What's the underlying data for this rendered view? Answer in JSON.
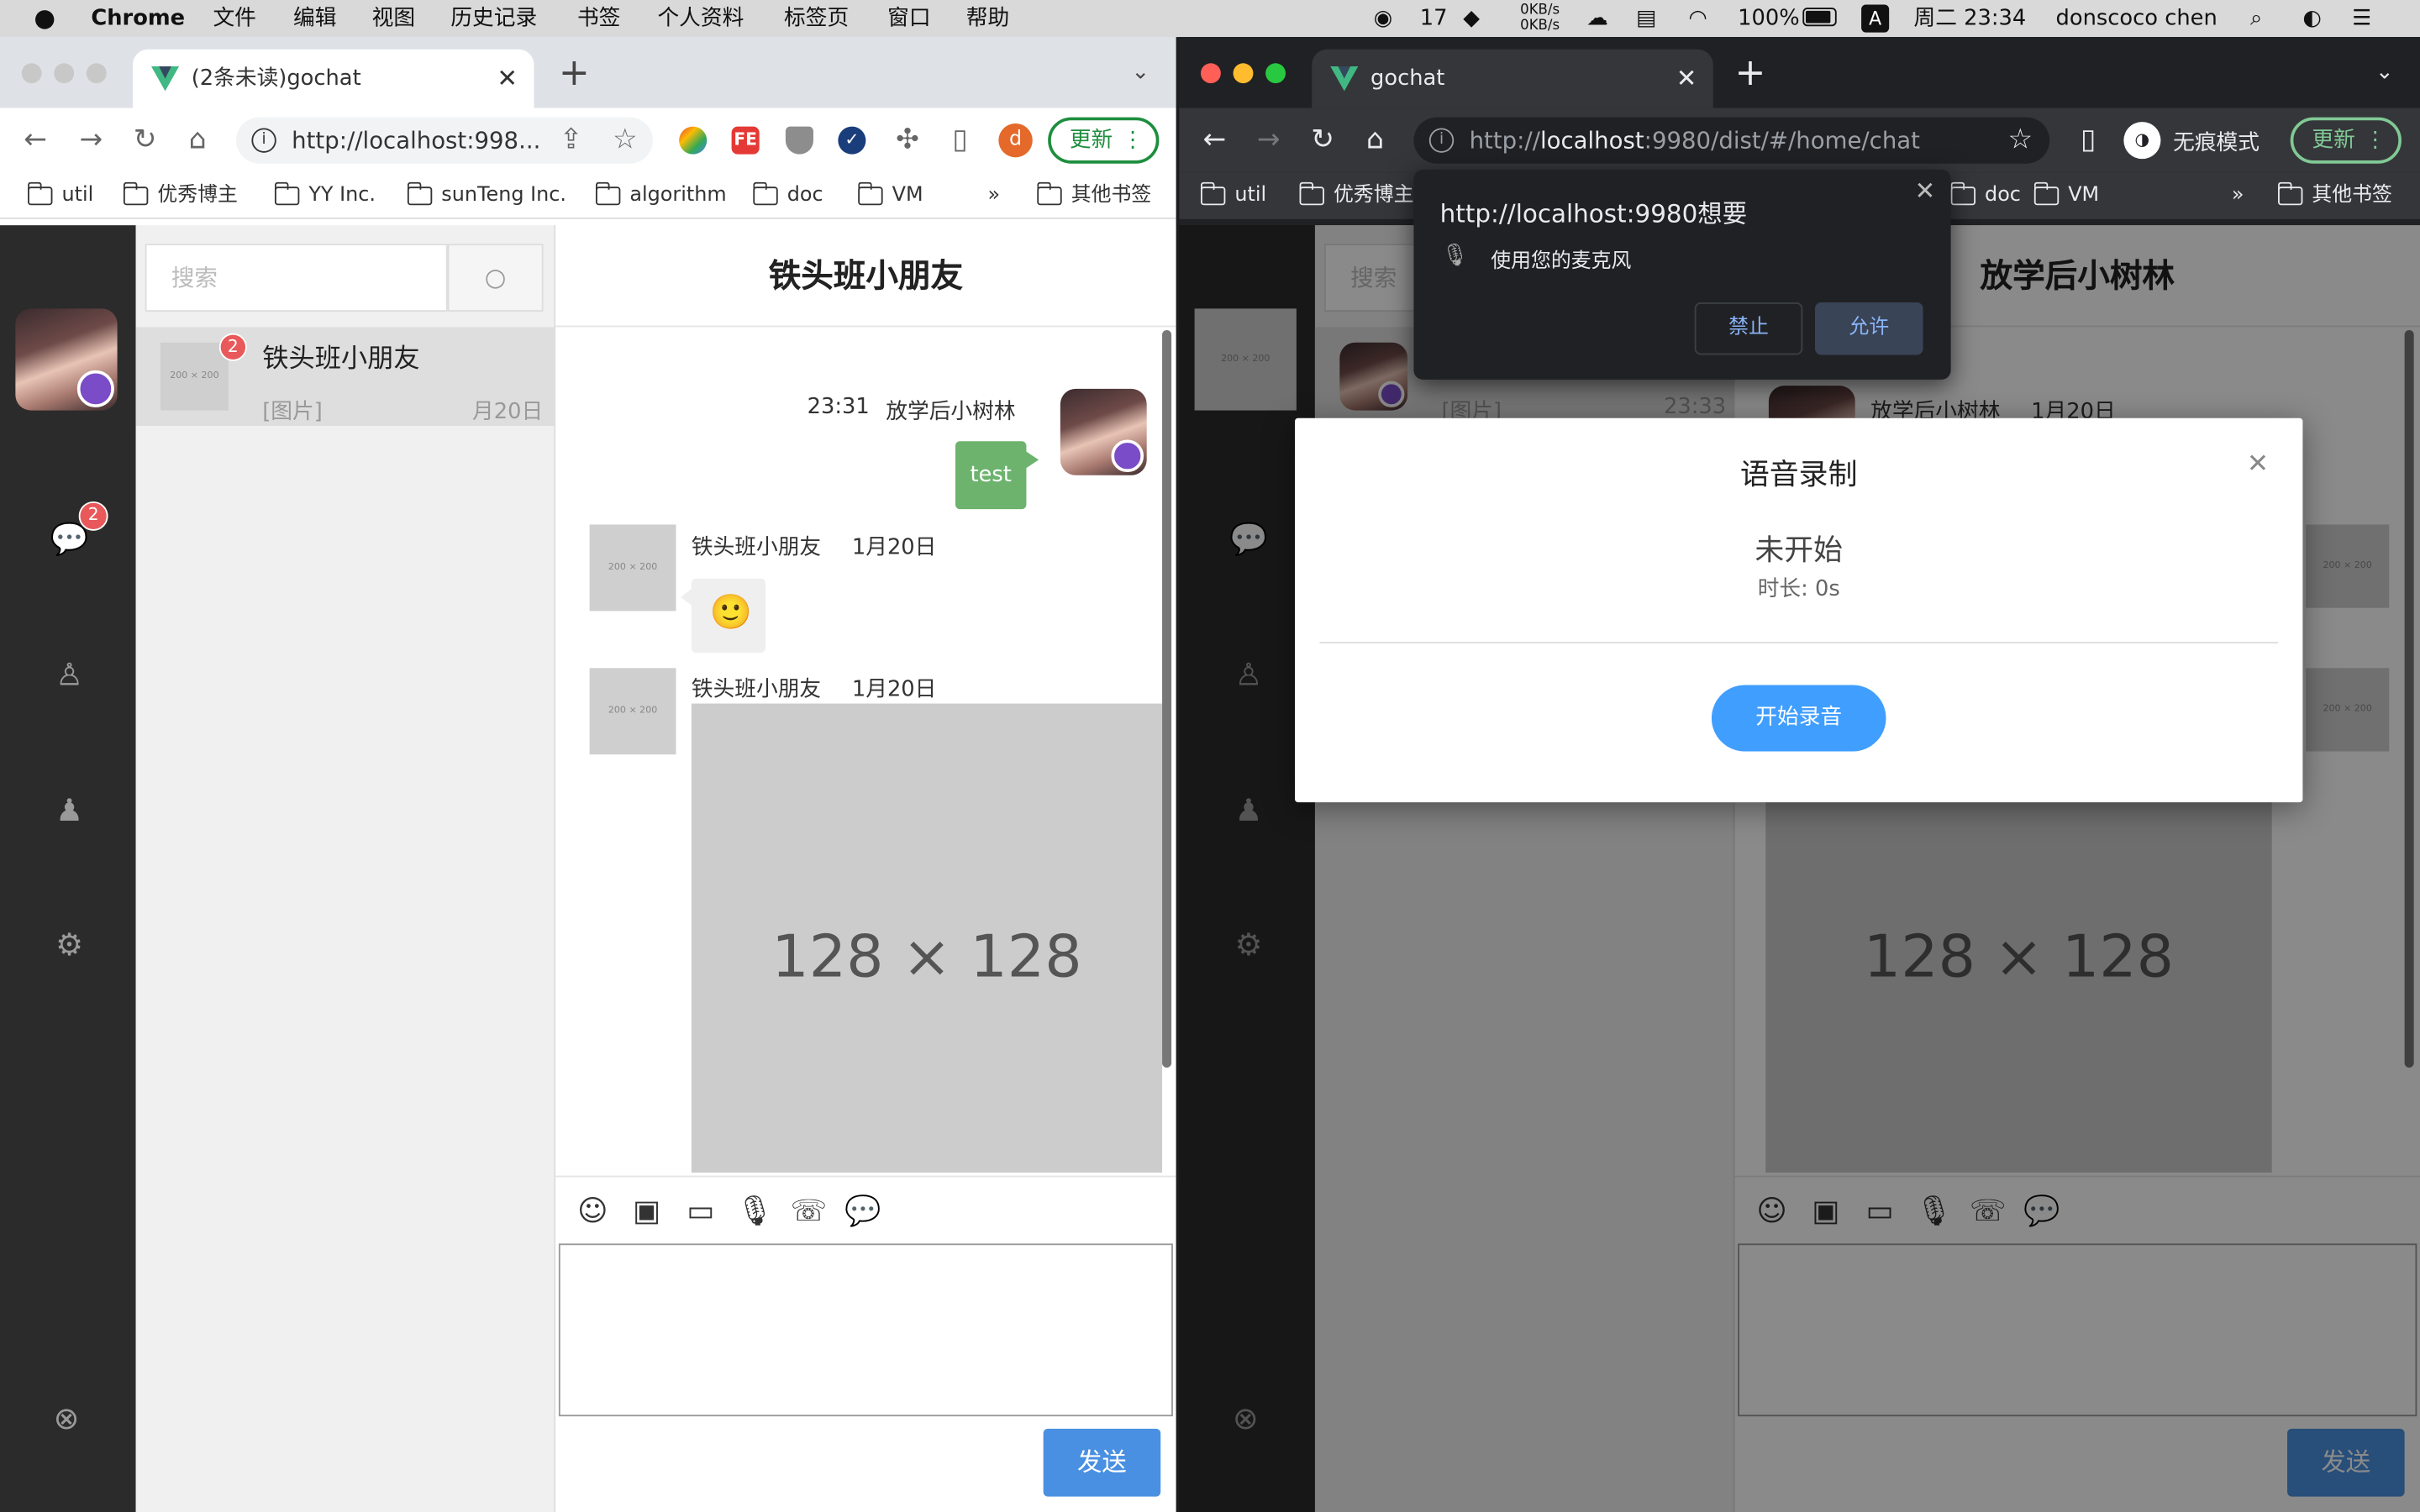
{
  "menubar": {
    "app_name": "Chrome",
    "menus": [
      "文件",
      "编辑",
      "视图",
      "历史记录",
      "书签",
      "个人资料",
      "标签页",
      "窗口",
      "帮助"
    ],
    "wechat_count": "17",
    "net_up": "0KB/s",
    "net_down": "0KB/s",
    "battery": "100%",
    "input_method": "A",
    "datetime": "周二 23:34",
    "user": "donscoco chen"
  },
  "left_window": {
    "tab_title": "(2条未读)gochat",
    "url": "http://localhost:998...",
    "profile_initial": "d",
    "update_label": "更新",
    "ext_fe": "FE",
    "bookmarks": [
      "util",
      "优秀博主",
      "YY Inc.",
      "sunTeng Inc.",
      "algorithm",
      "doc",
      "VM"
    ],
    "bookmarks_more": "»",
    "other_bookmarks": "其他书签"
  },
  "right_window": {
    "tab_title": "gochat",
    "url_prefix": "http://",
    "url_host": "localhost",
    "url_rest": ":9980/dist/#/home/chat",
    "incognito_label": "无痕模式",
    "update_label": "更新",
    "bookmarks": [
      "util",
      "优秀博主",
      "doc",
      "VM"
    ],
    "bookmarks_more": "»",
    "other_bookmarks": "其他书签"
  },
  "app_left": {
    "unread_badge": "2",
    "search_placeholder": "搜索",
    "contact": {
      "name": "铁头班小朋友",
      "preview": "[图片]",
      "date": "月20日",
      "badge": "2",
      "avatar_text": "200 × 200"
    },
    "chat_title": "铁头班小朋友",
    "messages": [
      {
        "time": "23:31",
        "sender": "放学后小树林",
        "text": "test"
      },
      {
        "sender": "铁头班小朋友",
        "date": "1月20日",
        "emoji": "🙂",
        "avatar_text": "200 × 200"
      },
      {
        "sender": "铁头班小朋友",
        "date": "1月20日",
        "image_text": "128 × 128",
        "avatar_text": "200 × 200"
      }
    ],
    "send_label": "发送"
  },
  "app_right": {
    "chat_title": "放学后小树林",
    "search_placeholder": "搜索",
    "contact": {
      "preview": "[图片]",
      "time": "23:33"
    },
    "header_sender": "放学后小树林",
    "header_date": "1月20日",
    "avatar_text": "200 × 200",
    "image_text": "128 × 128",
    "send_label": "发送"
  },
  "permission_popup": {
    "origin": "http://localhost:9980想要",
    "request": "使用您的麦克风",
    "deny_label": "禁止",
    "allow_label": "允许"
  },
  "voice_modal": {
    "title": "语音录制",
    "status": "未开始",
    "duration": "时长: 0s",
    "start_label": "开始录音"
  },
  "colors": {
    "accent": "#409eff",
    "send": "#4a90e2",
    "bubble_me": "#6db36e",
    "badge": "#e9585a",
    "sidebar": "#2b2b2b"
  }
}
